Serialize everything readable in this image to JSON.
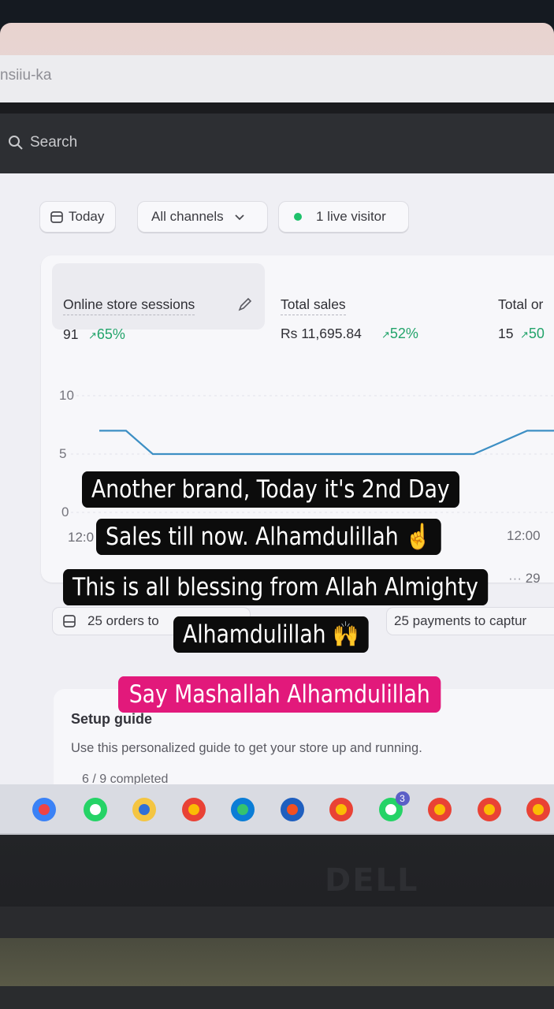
{
  "browser": {
    "url_fragment": "nsiiu-ka"
  },
  "topbar": {
    "search_label": "Search",
    "search_icon": "search-icon"
  },
  "filters": {
    "date": "Today",
    "channels": "All channels",
    "live_visitors": "1 live visitor",
    "live_color": "#1ec16b"
  },
  "metrics": [
    {
      "label": "Online store sessions",
      "value": "91",
      "change": "65%"
    },
    {
      "label": "Total sales",
      "value": "Rs 11,695.84",
      "change": "52%"
    },
    {
      "label": "Total or",
      "value": "15",
      "change": "50"
    }
  ],
  "chart_data": {
    "type": "line",
    "yticks": [
      "10",
      "5",
      "0"
    ],
    "ylim": [
      0,
      10
    ],
    "xticks": [
      "12:0",
      "12:00"
    ],
    "x_extra_label": "29",
    "series": [
      {
        "values": [
          7,
          7,
          5,
          5,
          5,
          5,
          5,
          5,
          5,
          5,
          5,
          5,
          5,
          5,
          5,
          6,
          7,
          7
        ]
      }
    ],
    "accent": "#3d8fc4"
  },
  "bottom_chips": {
    "orders": "25 orders to",
    "payments": "25 payments to captur"
  },
  "setup": {
    "title": "Setup guide",
    "description": "Use this personalized guide to get your store up and running.",
    "progress": "6 / 9 completed"
  },
  "taskbar": {
    "icons": [
      "copilot-icon",
      "whatsapp-icon",
      "file-explorer-icon",
      "chrome-icon",
      "edge-icon",
      "store-icon",
      "chrome-icon",
      "whatsapp-icon",
      "chrome-icon",
      "chrome-icon",
      "chrome-icon"
    ],
    "whatsapp_badge": "3"
  },
  "laptop": {
    "brand": "DELL"
  },
  "captions": {
    "line1": "Another brand, Today it's 2nd Day",
    "line2": "Sales till now. Alhamdulillah ☝️",
    "line3": "This is all blessing from Allah Almighty",
    "line4": "Alhamdulillah 🙌",
    "line5": "Say Mashallah Alhamdulillah",
    "pink": "#e2197b"
  }
}
